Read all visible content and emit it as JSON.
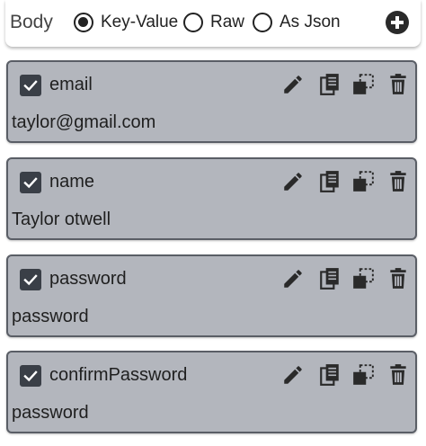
{
  "header": {
    "body_label": "Body",
    "options": [
      {
        "label": "Key-Value",
        "selected": true
      },
      {
        "label": "Raw",
        "selected": false
      },
      {
        "label": "As Json",
        "selected": false
      }
    ],
    "add_icon": "plus-circle-icon"
  },
  "fields": [
    {
      "key": "email",
      "value": "taylor@gmail.com",
      "enabled": true
    },
    {
      "key": "name",
      "value": "Taylor otwell",
      "enabled": true
    },
    {
      "key": "password",
      "value": "password",
      "enabled": true
    },
    {
      "key": "confirmPassword",
      "value": "password",
      "enabled": true
    }
  ],
  "icons": {
    "edit": "pencil-icon",
    "copy": "copy-icon",
    "duplicate": "duplicate-icon",
    "delete": "trash-icon"
  },
  "colors": {
    "card_bg": "#b3b6bd",
    "card_border": "#5a5e66",
    "checkbox": "#3a3f47",
    "icon": "#2a2a2a"
  }
}
